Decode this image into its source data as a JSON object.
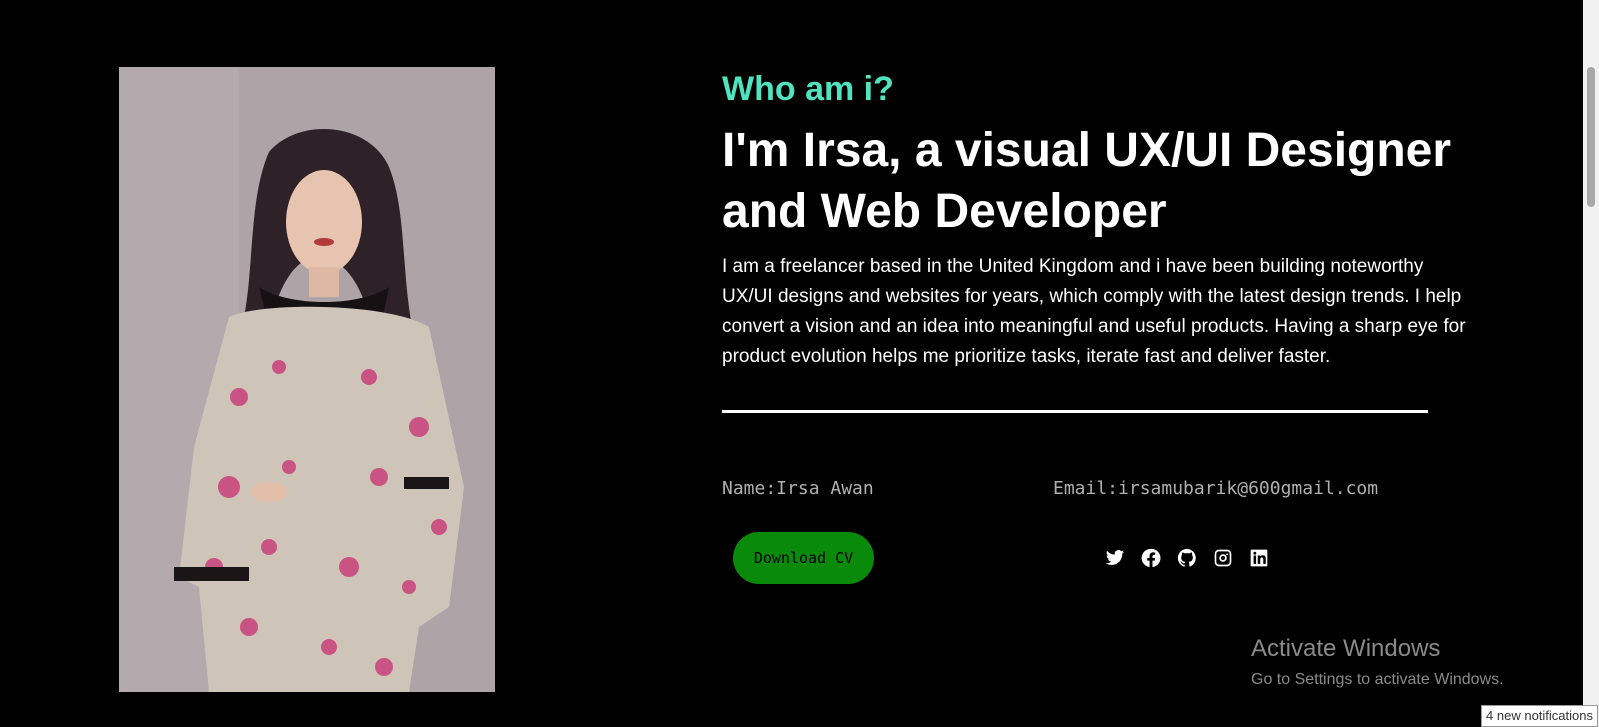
{
  "about": {
    "eyebrow": "Who am i?",
    "headline": "I'm Irsa, a visual UX/UI Designer and Web Developer",
    "bio": "I am a freelancer based in the United Kingdom and i have been building noteworthy UX/UI designs and websites for years, which comply with the latest design trends. I help convert a vision and an idea into meaningful and useful products. Having a sharp eye for product evolution helps me prioritize tasks, iterate fast and deliver faster.",
    "name_text": "Name:Irsa Awan",
    "email_text": "Email:irsamubarik@600gmail.com",
    "cv_label": "Download CV"
  },
  "socials": [
    {
      "icon": "twitter-icon"
    },
    {
      "icon": "facebook-icon"
    },
    {
      "icon": "github-icon"
    },
    {
      "icon": "instagram-icon"
    },
    {
      "icon": "linkedin-icon"
    }
  ],
  "watermark": {
    "title": "Activate Windows",
    "subtitle": "Go to Settings to activate Windows."
  },
  "notification": {
    "text": "4 new notifications"
  },
  "colors": {
    "accent": "#4fe3bf",
    "button": "#0a8a0a",
    "background": "#000000"
  }
}
